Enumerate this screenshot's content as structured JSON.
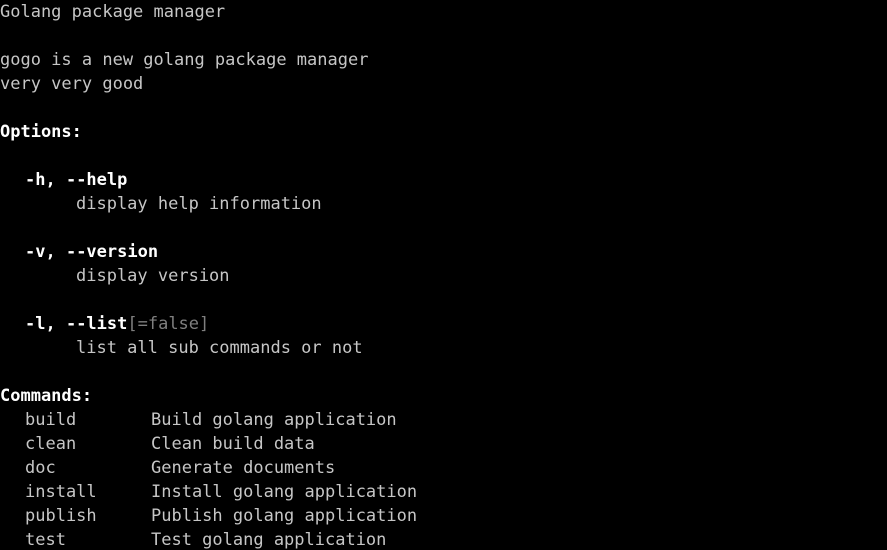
{
  "terminal": {
    "background_color": "#000000",
    "text_color": "#c6c6c6",
    "bold_color": "#ffffff",
    "faint_color": "#7f7f7f"
  },
  "header": {
    "title": "Golang package manager",
    "description_line1": "gogo is a new golang package manager",
    "description_line2": "very very good"
  },
  "options": {
    "heading": "Options:",
    "items": [
      {
        "short": "-h, ",
        "long": "--help",
        "default": "",
        "description": "display help information"
      },
      {
        "short": "-v, ",
        "long": "--version",
        "default": "",
        "description": "display version"
      },
      {
        "short": "-l, ",
        "long": "--list",
        "default": "[=false]",
        "description": "list all sub commands or not"
      }
    ]
  },
  "commands": {
    "heading": "Commands:",
    "items": [
      {
        "name": "build",
        "description": "Build golang application"
      },
      {
        "name": "clean",
        "description": "Clean build data"
      },
      {
        "name": "doc",
        "description": "Generate documents"
      },
      {
        "name": "install",
        "description": "Install golang application"
      },
      {
        "name": "publish",
        "description": "Publish golang application"
      },
      {
        "name": "test",
        "description": "Test golang application"
      }
    ]
  }
}
